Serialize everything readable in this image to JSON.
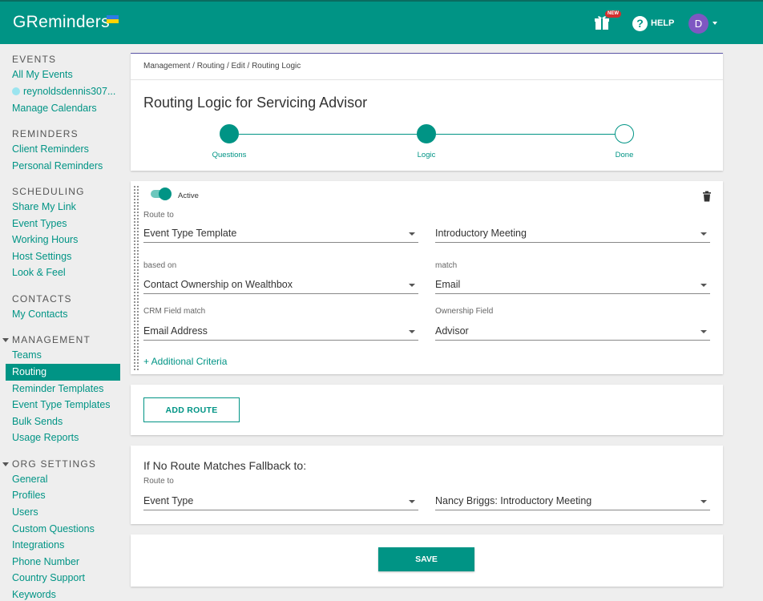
{
  "app": {
    "title": "GReminders"
  },
  "header": {
    "new_badge": "NEW",
    "help_label": "HELP",
    "avatar_initial": "D"
  },
  "sidebar": {
    "events": {
      "title": "EVENTS",
      "items": [
        "All My Events",
        "reynoldsdennis307...",
        "Manage Calendars"
      ]
    },
    "reminders": {
      "title": "REMINDERS",
      "items": [
        "Client Reminders",
        "Personal Reminders"
      ]
    },
    "scheduling": {
      "title": "SCHEDULING",
      "items": [
        "Share My Link",
        "Event Types",
        "Working Hours",
        "Host Settings",
        "Look & Feel"
      ]
    },
    "contacts": {
      "title": "CONTACTS",
      "items": [
        "My Contacts"
      ]
    },
    "management": {
      "title": "MANAGEMENT",
      "items": [
        "Teams",
        "Routing",
        "Reminder Templates",
        "Event Type Templates",
        "Bulk Sends",
        "Usage Reports"
      ],
      "active": "Routing"
    },
    "org_settings": {
      "title": "ORG SETTINGS",
      "items": [
        "General",
        "Profiles",
        "Users",
        "Custom Questions",
        "Integrations",
        "Phone Number",
        "Country Support",
        "Keywords"
      ]
    }
  },
  "breadcrumb": "Management / Routing / Edit / Routing Logic",
  "page_title": "Routing Logic for Servicing Advisor",
  "steps": [
    {
      "label": "Questions",
      "state": "complete"
    },
    {
      "label": "Logic",
      "state": "current"
    },
    {
      "label": "Done",
      "state": "pending"
    }
  ],
  "route": {
    "active_label": "Active",
    "active": true,
    "route_to": {
      "label": "Route to",
      "value": "Event Type Template",
      "target_value": "Introductory Meeting"
    },
    "based_on": {
      "label": "based on",
      "value": "Contact Ownership on Wealthbox"
    },
    "match": {
      "label": "match",
      "value": "Email"
    },
    "crm_field_match": {
      "label": "CRM Field match",
      "value": "Email Address"
    },
    "ownership_field": {
      "label": "Ownership Field",
      "value": "Advisor"
    },
    "additional_criteria": "+ Additional Criteria"
  },
  "add_route_label": "ADD ROUTE",
  "fallback": {
    "title": "If No Route Matches Fallback to:",
    "route_to_label": "Route to",
    "route_to_value": "Event Type",
    "target_value": "Nancy Briggs: Introductory Meeting"
  },
  "save_label": "SAVE",
  "colors": {
    "primary": "#009485",
    "avatar": "#7e57c2",
    "badge": "#d32f2f"
  }
}
